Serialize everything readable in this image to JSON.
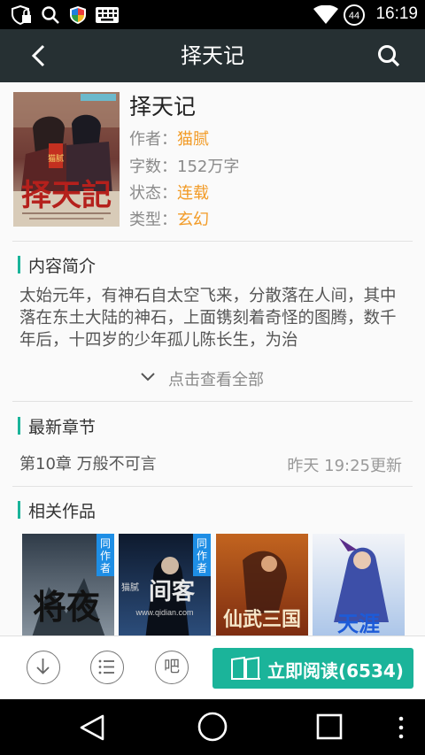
{
  "status_bar": {
    "time": "16:19",
    "battery_level": "44",
    "icons": [
      "shield-lock-icon",
      "search-icon",
      "security-shield-icon",
      "keyboard-icon",
      "wifi-icon",
      "battery-icon"
    ]
  },
  "app_bar": {
    "title": "择天记",
    "icons": [
      "back-arrow-icon",
      "search-icon"
    ]
  },
  "book": {
    "title": "择天记",
    "author_label": "作者：",
    "author": "猫腻",
    "words_label": "字数：",
    "words": "152万字",
    "status_label": "状态：",
    "status": "连载",
    "genre_label": "类型：",
    "genre": "玄幻",
    "cover_text": "择天記",
    "cover_brand": "猫腻"
  },
  "intro": {
    "heading": "内容简介",
    "text": "太始元年，有神石自太空飞来，分散落在人间，其中落在东土大陆的神石，上面镌刻着奇怪的图腾，数千年后，十四岁的少年孤儿陈长生，为治",
    "expand_label": "点击查看全部"
  },
  "latest": {
    "heading": "最新章节",
    "chapter": "第10章 万般不可言",
    "updated": "昨天 19:25更新"
  },
  "related": {
    "heading": "相关作品",
    "same_author_tag": "同作者",
    "items": [
      {
        "cover_text": "将夜",
        "tagged": true
      },
      {
        "cover_text": "间客",
        "tagged": true,
        "author": "猫腻",
        "site": "www.qidian.com"
      },
      {
        "cover_text": "仙武三国",
        "tagged": false
      },
      {
        "cover_text": "天涯",
        "tagged": false
      }
    ]
  },
  "actions": {
    "download_icon": "download-icon",
    "chapters_icon": "list-icon",
    "forum_label": "吧",
    "read_label": "立即阅读(6534)"
  },
  "colors": {
    "accent": "#1bb49a",
    "highlight": "#f29b26",
    "app_bar": "#263033",
    "tag_blue": "#1e8ee5"
  }
}
